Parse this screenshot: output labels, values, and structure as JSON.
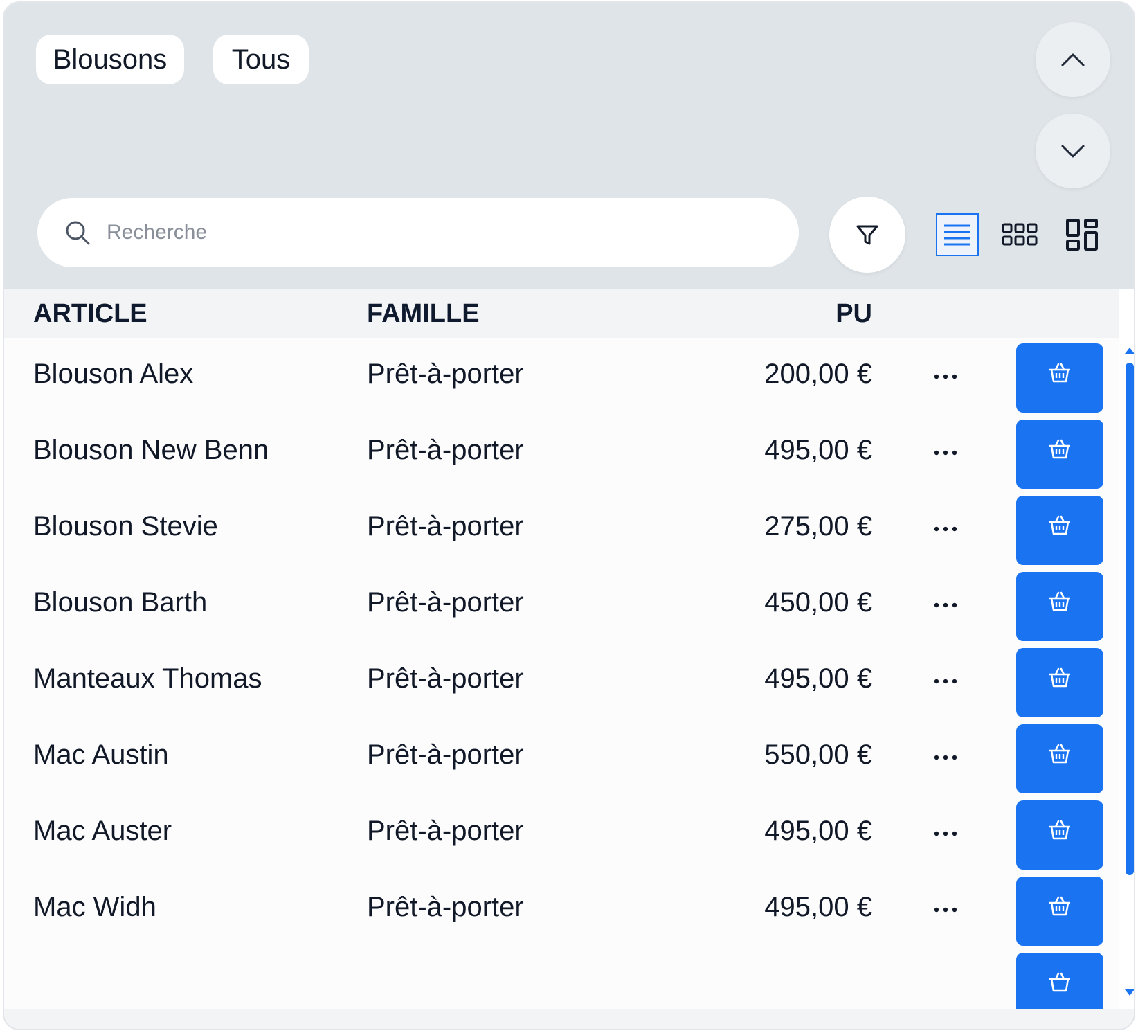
{
  "filters": {
    "chips": [
      "Blousons",
      "Tous"
    ]
  },
  "search": {
    "placeholder": "Recherche",
    "value": ""
  },
  "icons": {
    "search": "search-icon",
    "filter": "filter-icon",
    "scroll_up": "chevron-up-icon",
    "scroll_down": "chevron-down-icon",
    "view_list": "list-view-icon",
    "view_grid": "grid-view-icon",
    "view_mosaic": "mosaic-view-icon",
    "more": "more-dots-icon",
    "basket": "basket-icon"
  },
  "view_modes": {
    "selected": "list"
  },
  "colors": {
    "accent": "#1a73f0",
    "panel_bg": "#dee4e8",
    "header_bg": "#f3f4f6",
    "text": "#111827"
  },
  "table": {
    "headers": {
      "article": "ARTICLE",
      "famille": "FAMILLE",
      "pu": "PU"
    },
    "rows": [
      {
        "article": "Blouson Alex",
        "famille": "Prêt-à-porter",
        "pu": "200,00 €"
      },
      {
        "article": "Blouson New Benn",
        "famille": "Prêt-à-porter",
        "pu": "495,00 €"
      },
      {
        "article": "Blouson Stevie",
        "famille": "Prêt-à-porter",
        "pu": "275,00 €"
      },
      {
        "article": "Blouson Barth",
        "famille": "Prêt-à-porter",
        "pu": "450,00 €"
      },
      {
        "article": "Manteaux Thomas",
        "famille": "Prêt-à-porter",
        "pu": "495,00 €"
      },
      {
        "article": "Mac Austin",
        "famille": "Prêt-à-porter",
        "pu": "550,00 €"
      },
      {
        "article": "Mac Auster",
        "famille": "Prêt-à-porter",
        "pu": "495,00 €"
      },
      {
        "article": "Mac Widh",
        "famille": "Prêt-à-porter",
        "pu": "495,00 €"
      }
    ]
  }
}
